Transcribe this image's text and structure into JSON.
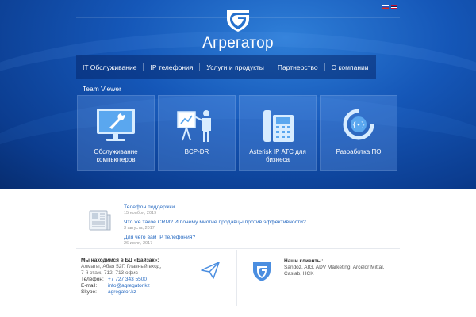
{
  "header": {
    "logo_text": "Агрегатор",
    "languages": [
      {
        "code": "ru",
        "icon": "flag-ru-icon"
      },
      {
        "code": "en",
        "icon": "flag-en-icon"
      }
    ]
  },
  "nav": {
    "items": [
      {
        "label": "IT Обслуживание"
      },
      {
        "label": "IP телефония"
      },
      {
        "label": "Услуги и продукты"
      },
      {
        "label": "Партнерство"
      },
      {
        "label": "О компании"
      }
    ]
  },
  "services": {
    "section_title": "Team Viewer",
    "tiles": [
      {
        "label": "Обслуживание компьютеров",
        "icon": "monitor-wrench-icon"
      },
      {
        "label": "BCP-DR",
        "icon": "presentation-icon"
      },
      {
        "label": "Asterisk IP АТС для бизнеса",
        "icon": "desk-phone-icon"
      },
      {
        "label": "Разработка ПО",
        "icon": "code-circle-icon"
      }
    ]
  },
  "news": {
    "icon": "newspaper-icon",
    "items": [
      {
        "title": "Телефон поддержки",
        "date": "15 ноября, 2019"
      },
      {
        "title": "Что же такое CRM? И почему многие продавцы против эффективности?",
        "date": "3 августа, 2017"
      },
      {
        "title": "Для чего вам IP телефония?",
        "date": "26 июля, 2017"
      }
    ]
  },
  "contacts": {
    "heading": "Мы находимся в БЦ «Байзак»:",
    "address_line1": "Алматы, Абая 52Г. Главный вход,",
    "address_line2": "7-й этаж, 712, 713 офис",
    "phone_label": "Телефон:",
    "phone_value": "+7 727 343 5500",
    "email_label": "E-mail:",
    "email_value": "info@agregator.kz",
    "skype_label": "Skype:",
    "skype_value": "agregator.kz"
  },
  "clients": {
    "heading": "Наши клиенты:",
    "line1": "Sandoz, AIG, ADV Marketing, Arcelor Mittal,",
    "line2": "Caslab, HCK"
  },
  "colors": {
    "hero_blue": "#1557b8",
    "link_blue": "#2a6cc2",
    "icon_blue": "#4b8ee0"
  }
}
